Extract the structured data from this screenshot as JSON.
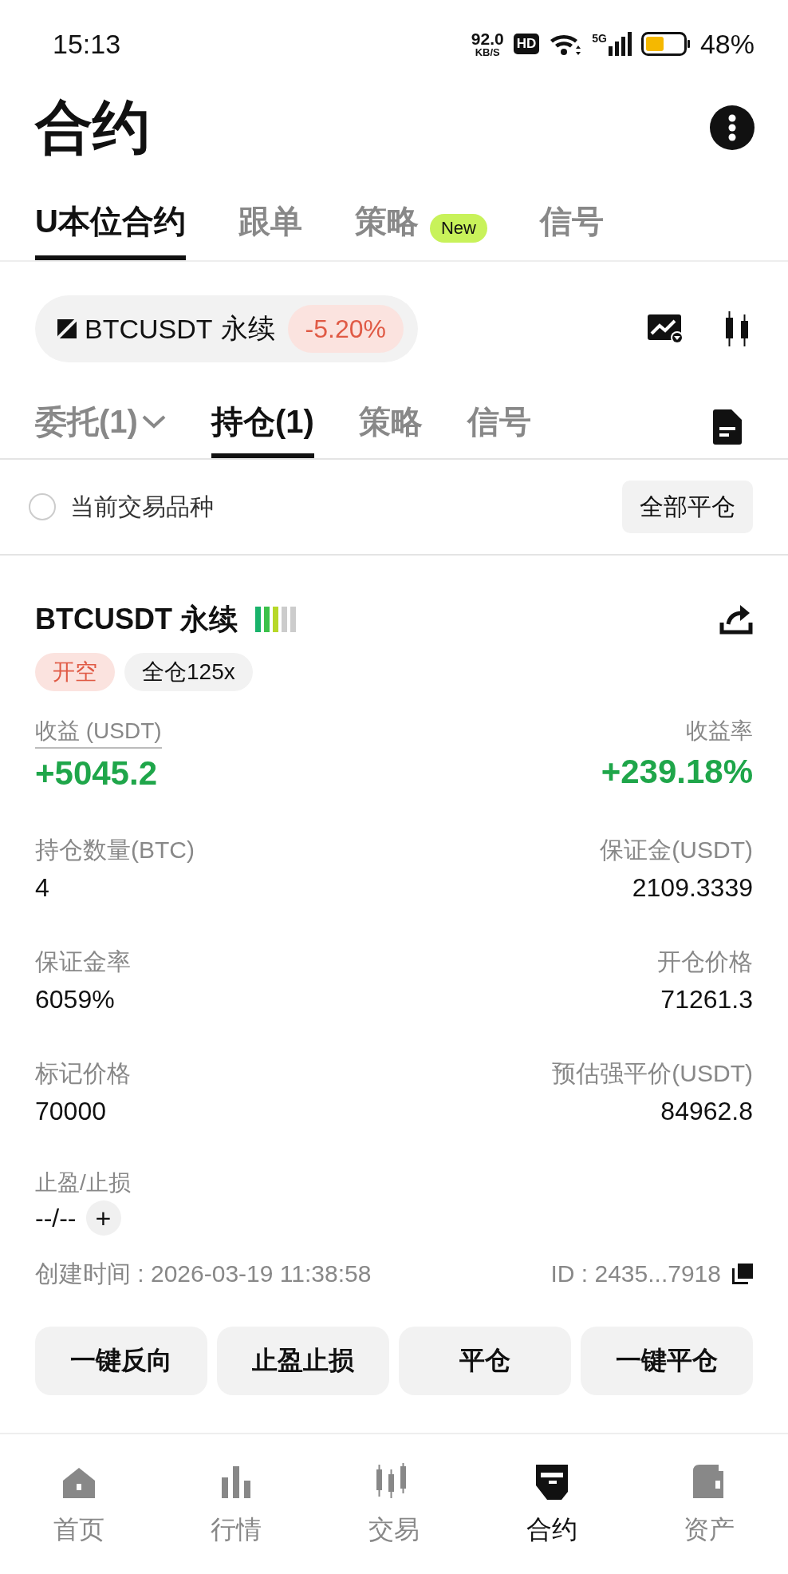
{
  "status_bar": {
    "time": "15:13",
    "net_speed": "92.0",
    "net_unit": "KB/S",
    "hd": "HD",
    "network": "5G",
    "battery": "48%"
  },
  "header": {
    "title": "合约"
  },
  "top_tabs": [
    {
      "label": "U本位合约",
      "selected": true
    },
    {
      "label": "跟单",
      "selected": false
    },
    {
      "label": "策略",
      "selected": false,
      "badge": "New"
    },
    {
      "label": "信号",
      "selected": false
    }
  ],
  "symbol_bar": {
    "symbol": "BTCUSDT",
    "contract": "永续",
    "change": "-5.20%"
  },
  "sub_tabs": [
    {
      "label": "委托(1)",
      "selected": false,
      "dropdown": true
    },
    {
      "label": "持仓(1)",
      "selected": true,
      "dropdown": false
    },
    {
      "label": "策略",
      "selected": false,
      "dropdown": false
    },
    {
      "label": "信号",
      "selected": false,
      "dropdown": false
    }
  ],
  "filter": {
    "label": "当前交易品种",
    "checked": false,
    "close_all": "全部平仓"
  },
  "position": {
    "symbol": "BTCUSDT 永续",
    "tags": [
      {
        "label": "开空",
        "kind": "side"
      },
      {
        "label": "全仓125x",
        "kind": "margin"
      }
    ],
    "pnl": {
      "label": "收益 (USDT)",
      "value": "+5045.2"
    },
    "roe": {
      "label": "收益率",
      "value": "+239.18%"
    },
    "fields": [
      {
        "label": "持仓数量(BTC)",
        "value": "4"
      },
      {
        "label": "保证金(USDT)",
        "value": "2109.3339"
      },
      {
        "label": "保证金率",
        "value": "6059%"
      },
      {
        "label": "开仓价格",
        "value": "71261.3"
      },
      {
        "label": "标记价格",
        "value": "70000"
      },
      {
        "label": "预估强平价(USDT)",
        "value": "84962.8"
      }
    ],
    "tpsl": {
      "label": "止盈/止损",
      "value": "--/--",
      "add": "+"
    },
    "created": "创建时间 : 2026-03-19 11:38:58",
    "id": "ID : 2435...7918",
    "actions": [
      "一键反向",
      "止盈止损",
      "平仓",
      "一键平仓"
    ]
  },
  "bottom_nav": [
    {
      "label": "首页",
      "selected": false
    },
    {
      "label": "行情",
      "selected": false
    },
    {
      "label": "交易",
      "selected": false
    },
    {
      "label": "合约",
      "selected": true
    },
    {
      "label": "资产",
      "selected": false
    }
  ]
}
